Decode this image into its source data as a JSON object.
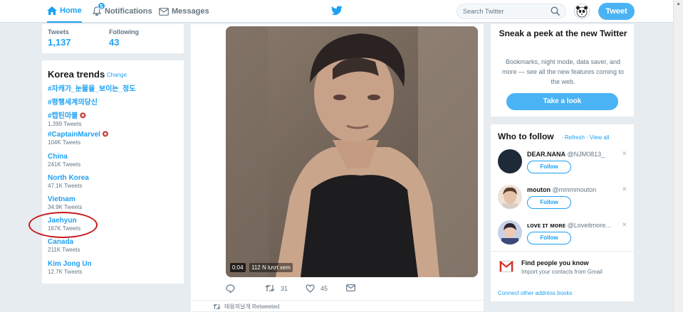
{
  "nav": {
    "home": "Home",
    "notifications": "Notifications",
    "notification_count": "5",
    "messages": "Messages",
    "search_placeholder": "Search Twitter",
    "tweet": "Tweet"
  },
  "stats": {
    "tweets_label": "Tweets",
    "tweets_value": "1,137",
    "following_label": "Following",
    "following_value": "43"
  },
  "trends": {
    "title": "Korea trends",
    "change": "· Change",
    "items": [
      {
        "name": "#자캐가_눈물을_보이는_정도",
        "count": ""
      },
      {
        "name": "#평행세계의당신",
        "count": ""
      },
      {
        "name": "#캡틴마블",
        "count": "1,399 Tweets"
      },
      {
        "name": "#CaptainMarvel",
        "count": "104K Tweets"
      },
      {
        "name": "China",
        "count": "241K Tweets"
      },
      {
        "name": "North Korea",
        "count": "47.1K Tweets"
      },
      {
        "name": "Vietnam",
        "count": "34.9K Tweets"
      },
      {
        "name": "Jaehyun",
        "count": "167K Tweets"
      },
      {
        "name": "Canada",
        "count": "211K Tweets"
      },
      {
        "name": "Kim Jong Un",
        "count": "12.7K Tweets"
      }
    ]
  },
  "tweet": {
    "video_time": "0:04",
    "video_views": "112 N lượt xem",
    "retweets": "31",
    "likes": "45",
    "retweeted_by": "태용의날개 Retweeted"
  },
  "peek": {
    "title": "Sneak a peek at the new Twitter",
    "text": "Bookmarks, night mode, data saver, and more — see all the new features coming to the web.",
    "button": "Take a look"
  },
  "who_to_follow": {
    "title": "Who to follow",
    "links": "· Refresh · View all",
    "follow_label": "Follow",
    "users": [
      {
        "name": "DEAR.NANA",
        "handle": "@NJM0813_"
      },
      {
        "name": "mouton",
        "handle": "@mmmmouton"
      },
      {
        "name": "ʟᴏᴠᴇ ɪᴛ ᴍᴏʀᴇ",
        "handle": "@Loveitmore..."
      }
    ],
    "find_title": "Find people you know",
    "find_sub": "Import your contacts from Gmail",
    "connect": "Connect other address books"
  }
}
